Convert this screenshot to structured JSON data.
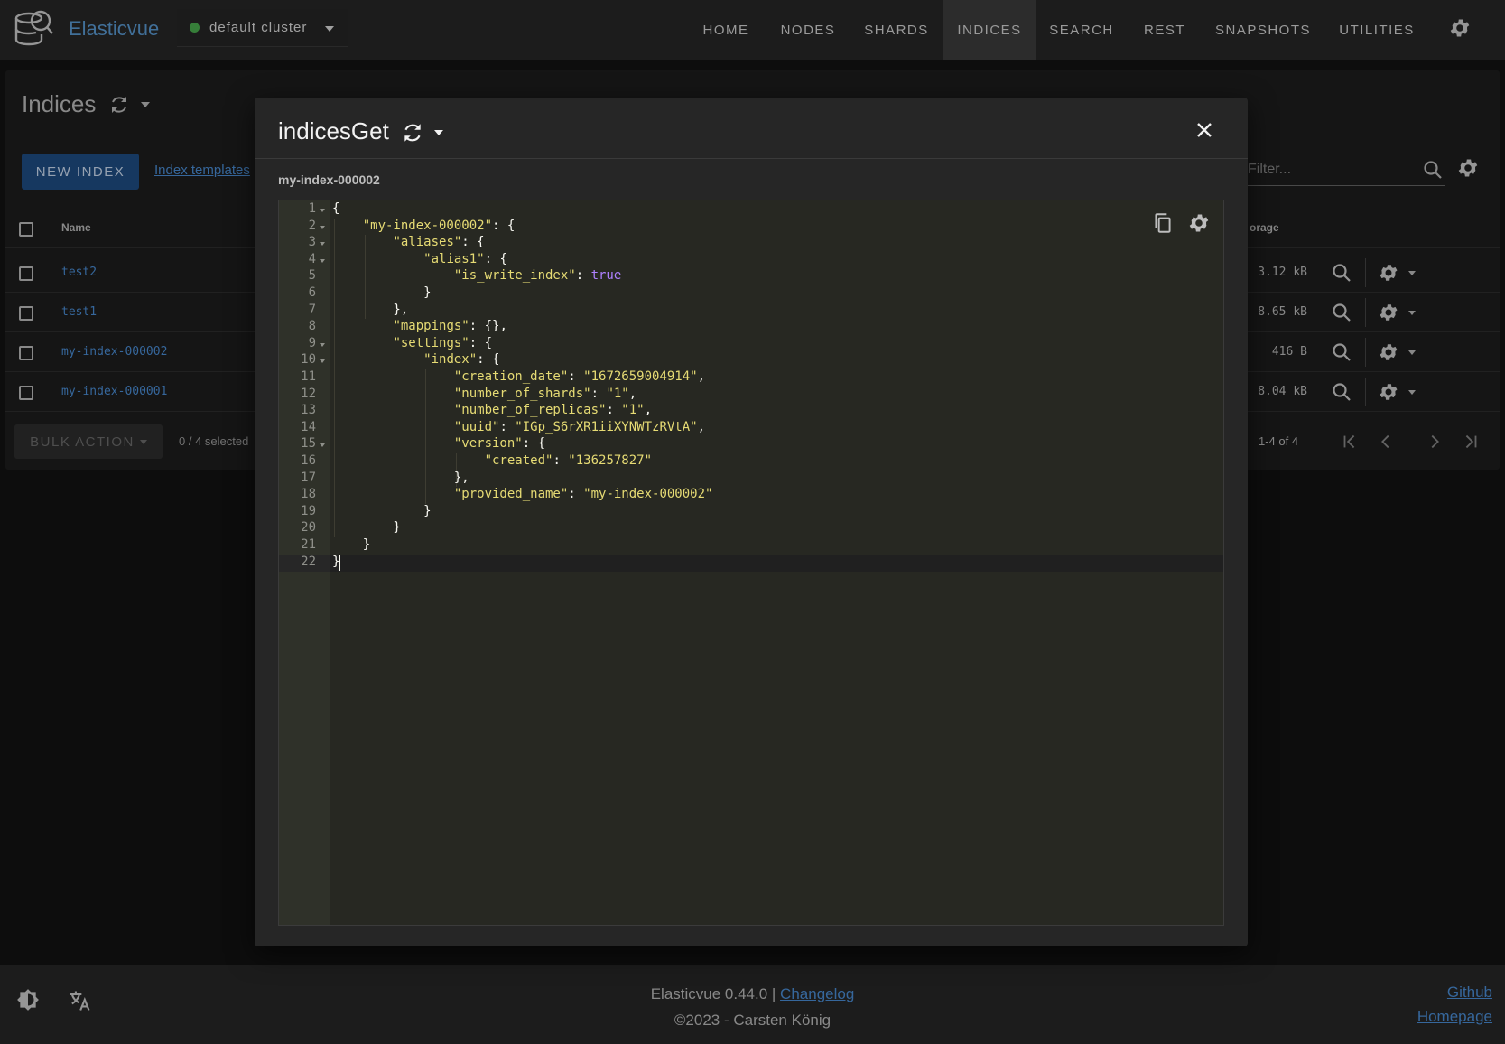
{
  "app": {
    "name": "Elasticvue",
    "cluster_label": "default cluster",
    "cluster_status_color": "#4caf50"
  },
  "nav": {
    "home": "HOME",
    "nodes": "NODES",
    "shards": "SHARDS",
    "indices": "INDICES",
    "search": "SEARCH",
    "rest": "REST",
    "snapshots": "SNAPSHOTS",
    "utilities": "UTILITIES",
    "active": "INDICES"
  },
  "page": {
    "title": "Indices",
    "new_index_label": "NEW INDEX",
    "index_templates_label": "Index templates",
    "filter_placeholder": "Filter...",
    "bulk_action_label": "BULK ACTION",
    "selected_text": "0 / 4 selected",
    "pagination_text": "1-4 of 4"
  },
  "table": {
    "headers": {
      "name": "Name",
      "storage": "orage"
    },
    "rows": [
      {
        "name": "test2",
        "size": "3.12 kB"
      },
      {
        "name": "test1",
        "size": "8.65 kB"
      },
      {
        "name": "my-index-000002",
        "size": "416 B"
      },
      {
        "name": "my-index-000001",
        "size": "8.04 kB"
      }
    ]
  },
  "modal": {
    "title": "indicesGet",
    "subtitle": "my-index-000002",
    "lines": [
      "{",
      "    \"my-index-000002\": {",
      "        \"aliases\": {",
      "            \"alias1\": {",
      "                \"is_write_index\": true",
      "            }",
      "        },",
      "        \"mappings\": {},",
      "        \"settings\": {",
      "            \"index\": {",
      "                \"creation_date\": \"1672659004914\",",
      "                \"number_of_shards\": \"1\",",
      "                \"number_of_replicas\": \"1\",",
      "                \"uuid\": \"IGp_S6rXR1iiXYNWTzRVtA\",",
      "                \"version\": {",
      "                    \"created\": \"136257827\"",
      "                },",
      "                \"provided_name\": \"my-index-000002\"",
      "            }",
      "        }",
      "    }",
      "}"
    ],
    "fold_lines": [
      1,
      2,
      3,
      4,
      9,
      10,
      15
    ]
  },
  "footer": {
    "version_text": "Elasticvue 0.44.0 | ",
    "changelog_label": "Changelog",
    "copyright": "©2023 - Carsten König",
    "github_label": "Github",
    "homepage_label": "Homepage"
  }
}
